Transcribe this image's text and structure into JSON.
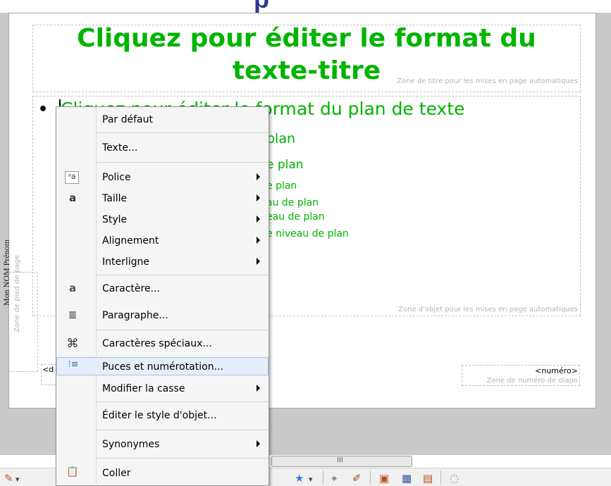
{
  "slide": {
    "title": "Cliquez pour éditer le format du texte-titre",
    "title_zone_label": "Zone de titre pour les mises en page automatiques",
    "outline_zone_label": "Zone d'objet pour les mises en page automatiques",
    "outline_lines": [
      "Cliquez pour éditer le format du plan de texte",
      "plan",
      "e plan",
      "e plan",
      "au de plan",
      "eau de plan",
      "e niveau de plan"
    ],
    "bullet": "•",
    "side_text": "Mon NOM Prénom",
    "side_zone_label": "Zone de pied de page",
    "date_placeholder": "<d",
    "number_placeholder": "<numéro>",
    "number_zone_label": "Zone de numéro de diapo"
  },
  "scrollbar": {
    "grip": "III"
  },
  "context_menu": {
    "items": [
      {
        "label": "Par défaut",
        "icon": "",
        "submenu": false
      },
      {
        "label": "Texte...",
        "icon": "",
        "submenu": false
      },
      {
        "label": "Police",
        "icon": "font-icon",
        "glyph": "ᵃa",
        "submenu": true
      },
      {
        "label": "Taille",
        "icon": "font-size-icon",
        "glyph": "a",
        "submenu": true
      },
      {
        "label": "Style",
        "icon": "",
        "submenu": true
      },
      {
        "label": "Alignement",
        "icon": "",
        "submenu": true
      },
      {
        "label": "Interligne",
        "icon": "",
        "submenu": true
      },
      {
        "label": "Caractère...",
        "icon": "character-icon",
        "glyph": "a",
        "submenu": false
      },
      {
        "label": "Paragraphe...",
        "icon": "paragraph-icon",
        "glyph": "≣",
        "submenu": false
      },
      {
        "label": "Caractères spéciaux...",
        "icon": "special-characters-icon",
        "glyph": "⌘",
        "submenu": false
      },
      {
        "label": "Puces et numérotation...",
        "icon": "bullets-icon",
        "glyph": "⁝≡",
        "submenu": false,
        "highlighted": true
      },
      {
        "label": "Modifier la casse",
        "icon": "",
        "submenu": true
      },
      {
        "label": "Éditer le style d'objet...",
        "icon": "",
        "submenu": false
      },
      {
        "label": "Synonymes",
        "icon": "",
        "submenu": true
      },
      {
        "label": "Coller",
        "icon": "paste-icon",
        "glyph": "📋",
        "submenu": false
      }
    ]
  },
  "toolbar": {
    "icons": [
      {
        "name": "pencil-icon",
        "glyph": "✎"
      },
      {
        "name": "dropdown-icon",
        "glyph": "▾"
      },
      {
        "name": "star-icon",
        "glyph": "★"
      },
      {
        "name": "dropdown-icon",
        "glyph": "▾"
      },
      {
        "name": "polygon-icon",
        "glyph": "⌖"
      },
      {
        "name": "marker-icon",
        "glyph": "✐"
      },
      {
        "name": "image-icon",
        "glyph": "▣"
      },
      {
        "name": "chart-icon",
        "glyph": "▦"
      },
      {
        "name": "frame-icon",
        "glyph": "▤"
      },
      {
        "name": "extrusion-icon",
        "glyph": "◌"
      }
    ]
  },
  "colors": {
    "title_green": "#00b400",
    "menu_highlight": "#e6eef9",
    "workspace_gray": "#c9c9c9"
  }
}
